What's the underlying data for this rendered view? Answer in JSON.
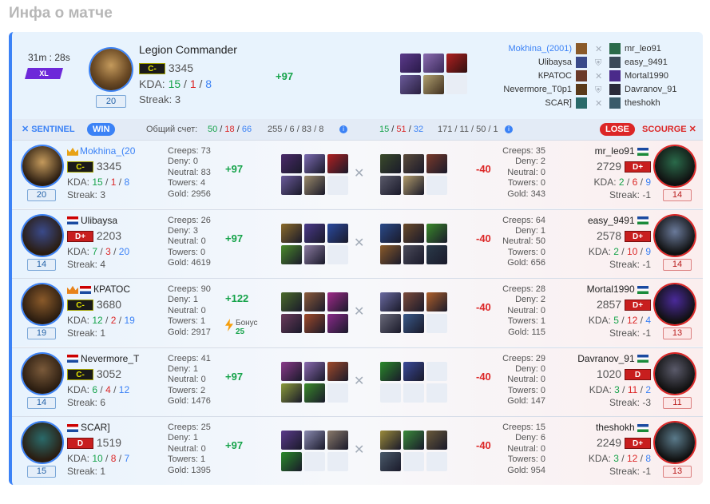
{
  "page_title": "Инфа о матче",
  "match": {
    "duration": "31m : 28s",
    "size_badge": "XL",
    "hero": "Legion Commander",
    "rank": "C-",
    "mmr": "3345",
    "kda": {
      "k": "15",
      "d": "1",
      "a": "8"
    },
    "kda_label": "KDA:",
    "streak_label": "Streak:",
    "streak": "3",
    "level": "20",
    "mmr_change": "+97"
  },
  "roster": {
    "left": [
      "Mokhina_(2001)",
      "Ulibaysa",
      "КРАТОС",
      "Nevermore_T0p1",
      "SCAR]"
    ],
    "right": [
      "mr_leo91",
      "easy_9491",
      "Mortal1990",
      "Davranov_91",
      "theshokh"
    ]
  },
  "header": {
    "sentinel": "SENTINEL",
    "win": "WIN",
    "score_label": "Общий счет:",
    "score_k": "50",
    "score_d": "18",
    "score_a": "66",
    "sent_totals": "255 / 6 / 83 / 8",
    "dire_k": "15",
    "dire_d": "51",
    "dire_a": "32",
    "dire_totals": "171 / 11 / 50 / 1",
    "lose": "LOSE",
    "scourge": "SCOURGE"
  },
  "stat_labels": {
    "creeps": "Creeps:",
    "deny": "Deny:",
    "neutral": "Neutral:",
    "towers": "Towers:",
    "gold": "Gold:"
  },
  "bonus": {
    "label": "Бонус",
    "value": "25"
  },
  "rows": [
    {
      "name": "Mokhina_(20",
      "rank": "C-",
      "rank_type": "c",
      "mmr": "3345",
      "kda": [
        "15",
        "1",
        "8"
      ],
      "streak": "3",
      "level": "20",
      "stats": [
        "73",
        "0",
        "83",
        "4",
        "2956"
      ],
      "mmr_change": "+97",
      "opp_name": "mr_leo91",
      "opp_rank": "D+",
      "opp_mmr": "2729",
      "opp_kda": [
        "2",
        "6",
        "9"
      ],
      "opp_streak": "-1",
      "opp_level": "14",
      "opp_stats": [
        "35",
        "2",
        "0",
        "0",
        "343"
      ],
      "opp_change": "-40"
    },
    {
      "name": "Ulibaysa",
      "rank": "D+",
      "rank_type": "d",
      "mmr": "2203",
      "kda": [
        "7",
        "3",
        "20"
      ],
      "streak": "4",
      "level": "14",
      "stats": [
        "26",
        "3",
        "0",
        "0",
        "4619"
      ],
      "mmr_change": "+97",
      "opp_name": "easy_9491",
      "opp_rank": "D+",
      "opp_mmr": "2578",
      "opp_kda": [
        "2",
        "10",
        "9"
      ],
      "opp_streak": "-1",
      "opp_level": "14",
      "opp_stats": [
        "64",
        "1",
        "50",
        "0",
        "656"
      ],
      "opp_change": "-40"
    },
    {
      "name": "КРАТОС",
      "rank": "C-",
      "rank_type": "c",
      "mmr": "3680",
      "kda": [
        "12",
        "2",
        "19"
      ],
      "streak": "1",
      "level": "19",
      "stats": [
        "90",
        "1",
        "0",
        "1",
        "2917"
      ],
      "mmr_change": "+122",
      "opp_name": "Mortal1990",
      "opp_rank": "D+",
      "opp_mmr": "2857",
      "opp_kda": [
        "5",
        "12",
        "4"
      ],
      "opp_streak": "-1",
      "opp_level": "13",
      "opp_stats": [
        "28",
        "2",
        "0",
        "1",
        "115"
      ],
      "opp_change": "-40"
    },
    {
      "name": "Nevermore_T",
      "rank": "C-",
      "rank_type": "c",
      "mmr": "3052",
      "kda": [
        "6",
        "4",
        "12"
      ],
      "streak": "6",
      "level": "14",
      "stats": [
        "41",
        "1",
        "0",
        "2",
        "1476"
      ],
      "mmr_change": "+97",
      "opp_name": "Davranov_91",
      "opp_rank": "D",
      "opp_mmr": "1020",
      "opp_kda": [
        "3",
        "11",
        "2"
      ],
      "opp_streak": "-3",
      "opp_level": "11",
      "opp_stats": [
        "29",
        "0",
        "0",
        "0",
        "147"
      ],
      "opp_change": "-40"
    },
    {
      "name": "SCAR]",
      "rank": "D",
      "rank_type": "d",
      "mmr": "1519",
      "kda": [
        "10",
        "8",
        "7"
      ],
      "streak": "1",
      "level": "15",
      "stats": [
        "25",
        "1",
        "0",
        "1",
        "1395"
      ],
      "mmr_change": "+97",
      "opp_name": "theshokh",
      "opp_rank": "D+",
      "opp_mmr": "2249",
      "opp_kda": [
        "3",
        "12",
        "8"
      ],
      "opp_streak": "-1",
      "opp_level": "13",
      "opp_stats": [
        "15",
        "6",
        "0",
        "0",
        "954"
      ],
      "opp_change": "-40"
    }
  ],
  "colors": {
    "win": "#3b82f6",
    "lose": "#dc2626",
    "positive": "#16a34a",
    "accent_purple": "#6d28d9"
  }
}
